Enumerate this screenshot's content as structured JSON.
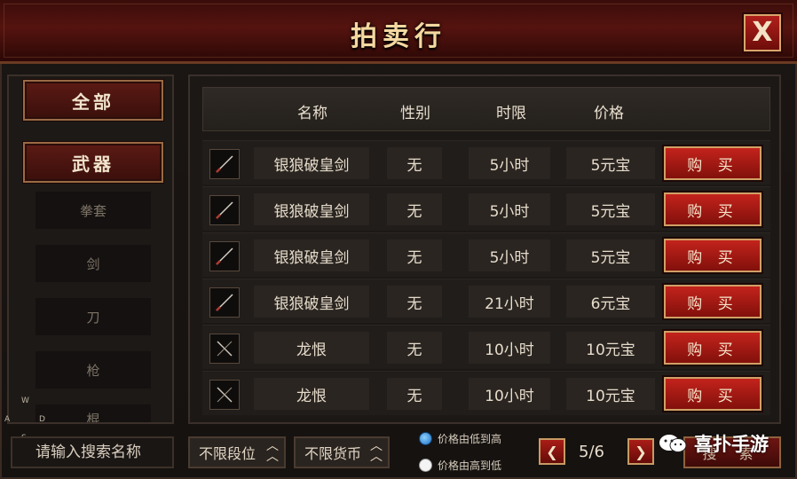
{
  "window": {
    "title": "拍卖行",
    "close_glyph": "X"
  },
  "categories": {
    "all": "全部",
    "weapon": "武器",
    "subs": [
      "拳套",
      "剑",
      "刀",
      "枪",
      "棍"
    ]
  },
  "table": {
    "headers": [
      "名称",
      "性别",
      "时限",
      "价格"
    ],
    "buy_label": "购 买",
    "rows": [
      {
        "icon": "sword-icon",
        "name": "银狼破皇剑",
        "gender": "无",
        "time": "5小时",
        "price": "5元宝"
      },
      {
        "icon": "sword-icon",
        "name": "银狼破皇剑",
        "gender": "无",
        "time": "5小时",
        "price": "5元宝"
      },
      {
        "icon": "sword-icon",
        "name": "银狼破皇剑",
        "gender": "无",
        "time": "5小时",
        "price": "5元宝"
      },
      {
        "icon": "sword-icon",
        "name": "银狼破皇剑",
        "gender": "无",
        "time": "21小时",
        "price": "6元宝"
      },
      {
        "icon": "staff-icon",
        "name": "龙恨",
        "gender": "无",
        "time": "10小时",
        "price": "10元宝"
      },
      {
        "icon": "staff-icon",
        "name": "龙恨",
        "gender": "无",
        "time": "10小时",
        "price": "10元宝"
      }
    ]
  },
  "bottom": {
    "search_placeholder": "请输入搜索名称",
    "filter_rank": "不限段位",
    "filter_currency": "不限货币",
    "sort_asc": "价格由低到高",
    "sort_desc": "价格由高到低",
    "sort_selected": "asc",
    "page": "5/6",
    "search_button": "搜 索"
  },
  "joystick": {
    "w": "W",
    "a": "A",
    "d": "D",
    "s": "S"
  },
  "watermark": "喜扑手游",
  "colors": {
    "accent_red": "#b0201b",
    "gold_border": "#d0a066"
  }
}
